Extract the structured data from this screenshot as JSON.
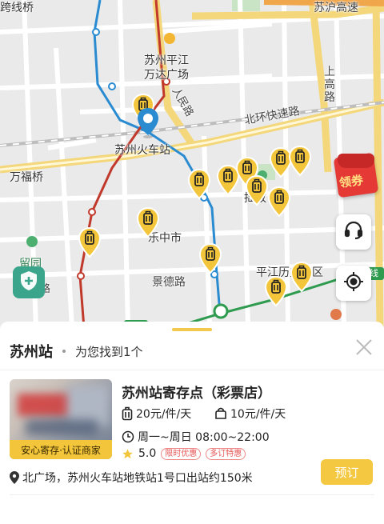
{
  "map": {
    "labels": {
      "top_left": "跨线桥",
      "top_right": "苏沪高速",
      "mall_line1": "苏州平江",
      "mall_line2": "万达广场",
      "north_ring": "北环快速路",
      "station": "苏州火车站",
      "wanfu_bridge": "万福桥",
      "gao_road": "上高路",
      "park_road_a": "人民路",
      "lezhong": "乐中市",
      "jingde_road": "景德路",
      "liuyuan": "留园",
      "liuyuan_road": "留园路",
      "pingjiang": "平江历史街区",
      "line_tag": "线",
      "zhuozheng": "拙政"
    },
    "coupon_label": "领券"
  },
  "icons": {
    "marker": "luggage-pin-icon",
    "location": "location-pin-icon",
    "service": "headset-icon",
    "locate": "crosshair-icon",
    "shield": "shield-plus-icon",
    "close": "close-icon",
    "luggage": "luggage-icon",
    "bag": "bag-icon",
    "clock": "clock-icon",
    "star": "star-icon",
    "pin": "map-pin-icon"
  },
  "panel": {
    "title": "苏州站",
    "count_text": "为您找到1个"
  },
  "shop": {
    "name": "苏州站寄存点（彩票店）",
    "image_tag": "安心寄存·认证商家",
    "price_large": "20元/件/天",
    "price_small": "10元/件/天",
    "hours": "周一~周日 08:00~22:00",
    "rating": "5.0",
    "badges": [
      "限时优惠",
      "多订特惠"
    ],
    "address": "北广场，苏州火车站地铁站1号口出站约150米",
    "book_label": "预订"
  },
  "colors": {
    "accent": "#f5c842",
    "marker": "#f3c53a",
    "metro_blue": "#2a8bd1",
    "metro_red": "#c0392b",
    "coupon": "#e53935"
  }
}
